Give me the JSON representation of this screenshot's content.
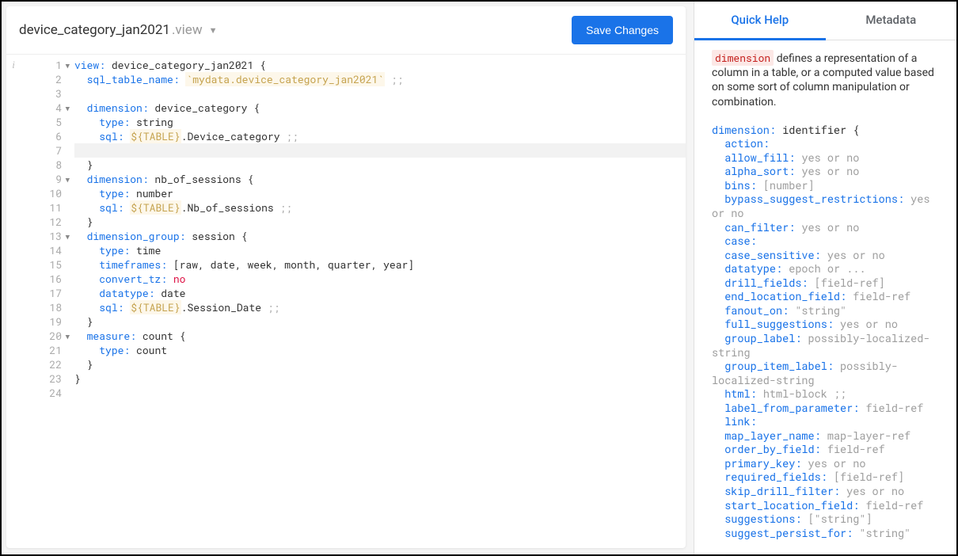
{
  "file": {
    "name": "device_category_jan2021",
    "ext": ".view"
  },
  "save_button": "Save Changes",
  "code_lines": [
    {
      "n": 1,
      "fold": true,
      "tokens": [
        [
          "kw",
          "view:"
        ],
        [
          "",
          " device_category_jan2021 {"
        ]
      ]
    },
    {
      "n": 2,
      "tokens": [
        [
          "",
          "  "
        ],
        [
          "kw",
          "sql_table_name:"
        ],
        [
          "",
          " "
        ],
        [
          "str",
          "`mydata.device_category_jan2021`"
        ],
        [
          "",
          " "
        ],
        [
          "punct",
          ";;"
        ]
      ]
    },
    {
      "n": 3,
      "tokens": []
    },
    {
      "n": 4,
      "fold": true,
      "tokens": [
        [
          "",
          "  "
        ],
        [
          "kw",
          "dimension:"
        ],
        [
          "",
          " device_category {"
        ]
      ]
    },
    {
      "n": 5,
      "tokens": [
        [
          "",
          "    "
        ],
        [
          "kw",
          "type:"
        ],
        [
          "",
          " string"
        ]
      ]
    },
    {
      "n": 6,
      "tokens": [
        [
          "",
          "    "
        ],
        [
          "kw",
          "sql:"
        ],
        [
          "",
          " "
        ],
        [
          "var",
          "${TABLE}"
        ],
        [
          "",
          ".Device_category "
        ],
        [
          "punct",
          ";;"
        ]
      ]
    },
    {
      "n": 7,
      "hl": true,
      "tokens": [
        [
          "",
          "    "
        ]
      ]
    },
    {
      "n": 8,
      "tokens": [
        [
          "",
          "  }"
        ]
      ]
    },
    {
      "n": 9,
      "fold": true,
      "tokens": [
        [
          "",
          "  "
        ],
        [
          "kw",
          "dimension:"
        ],
        [
          "",
          " nb_of_sessions {"
        ]
      ]
    },
    {
      "n": 10,
      "tokens": [
        [
          "",
          "    "
        ],
        [
          "kw",
          "type:"
        ],
        [
          "",
          " number"
        ]
      ]
    },
    {
      "n": 11,
      "tokens": [
        [
          "",
          "    "
        ],
        [
          "kw",
          "sql:"
        ],
        [
          "",
          " "
        ],
        [
          "var",
          "${TABLE}"
        ],
        [
          "",
          ".Nb_of_sessions "
        ],
        [
          "punct",
          ";;"
        ]
      ]
    },
    {
      "n": 12,
      "tokens": [
        [
          "",
          "  }"
        ]
      ]
    },
    {
      "n": 13,
      "fold": true,
      "tokens": [
        [
          "",
          "  "
        ],
        [
          "kw",
          "dimension_group:"
        ],
        [
          "",
          " session {"
        ]
      ]
    },
    {
      "n": 14,
      "tokens": [
        [
          "",
          "    "
        ],
        [
          "kw",
          "type:"
        ],
        [
          "",
          " time"
        ]
      ]
    },
    {
      "n": 15,
      "tokens": [
        [
          "",
          "    "
        ],
        [
          "kw",
          "timeframes:"
        ],
        [
          "",
          " [raw, date, week, month, quarter, year]"
        ]
      ]
    },
    {
      "n": 16,
      "tokens": [
        [
          "",
          "    "
        ],
        [
          "kw",
          "convert_tz:"
        ],
        [
          "",
          " "
        ],
        [
          "val",
          "no"
        ]
      ]
    },
    {
      "n": 17,
      "tokens": [
        [
          "",
          "    "
        ],
        [
          "kw",
          "datatype:"
        ],
        [
          "",
          " date"
        ]
      ]
    },
    {
      "n": 18,
      "tokens": [
        [
          "",
          "    "
        ],
        [
          "kw",
          "sql:"
        ],
        [
          "",
          " "
        ],
        [
          "var",
          "${TABLE}"
        ],
        [
          "",
          ".Session_Date "
        ],
        [
          "punct",
          ";;"
        ]
      ]
    },
    {
      "n": 19,
      "tokens": [
        [
          "",
          "  }"
        ]
      ]
    },
    {
      "n": 20,
      "fold": true,
      "tokens": [
        [
          "",
          "  "
        ],
        [
          "kw",
          "measure:"
        ],
        [
          "",
          " count {"
        ]
      ]
    },
    {
      "n": 21,
      "tokens": [
        [
          "",
          "    "
        ],
        [
          "kw",
          "type:"
        ],
        [
          "",
          " count"
        ]
      ]
    },
    {
      "n": 22,
      "tokens": [
        [
          "",
          "  }"
        ]
      ]
    },
    {
      "n": 23,
      "tokens": [
        [
          "",
          "}"
        ]
      ]
    },
    {
      "n": 24,
      "tokens": []
    }
  ],
  "tabs": {
    "quick_help": "Quick Help",
    "metadata": "Metadata"
  },
  "help": {
    "keyword": "dimension",
    "desc_rest": " defines a representation of a column in a table, or a computed value based on some sort of column manipulation or combination.",
    "header": {
      "k": "dimension:",
      "ident": " identifier {"
    },
    "props": [
      {
        "k": "action:",
        "v": ""
      },
      {
        "k": "allow_fill:",
        "v": "yes or no"
      },
      {
        "k": "alpha_sort:",
        "v": "yes or no"
      },
      {
        "k": "bins:",
        "v": "[number]"
      },
      {
        "k": "bypass_suggest_restrictions:",
        "v": "yes or no"
      },
      {
        "k": "can_filter:",
        "v": "yes or no"
      },
      {
        "k": "case:",
        "v": ""
      },
      {
        "k": "case_sensitive:",
        "v": "yes or no"
      },
      {
        "k": "datatype:",
        "v": "epoch or ..."
      },
      {
        "k": "drill_fields:",
        "v": "[field-ref]"
      },
      {
        "k": "end_location_field:",
        "v": "field-ref"
      },
      {
        "k": "fanout_on:",
        "v": "\"string\""
      },
      {
        "k": "full_suggestions:",
        "v": "yes or no"
      },
      {
        "k": "group_label:",
        "v": "possibly-localized-string"
      },
      {
        "k": "group_item_label:",
        "v": "possibly-localized-string"
      },
      {
        "k": "html:",
        "v": "html-block ;;"
      },
      {
        "k": "label_from_parameter:",
        "v": "field-ref"
      },
      {
        "k": "link:",
        "v": ""
      },
      {
        "k": "map_layer_name:",
        "v": "map-layer-ref"
      },
      {
        "k": "order_by_field:",
        "v": "field-ref"
      },
      {
        "k": "primary_key:",
        "v": "yes or no"
      },
      {
        "k": "required_fields:",
        "v": "[field-ref]"
      },
      {
        "k": "skip_drill_filter:",
        "v": "yes or no"
      },
      {
        "k": "start_location_field:",
        "v": "field-ref"
      },
      {
        "k": "suggestions:",
        "v": "[\"string\"]"
      },
      {
        "k": "suggest_persist_for:",
        "v": "\"string\""
      }
    ]
  }
}
